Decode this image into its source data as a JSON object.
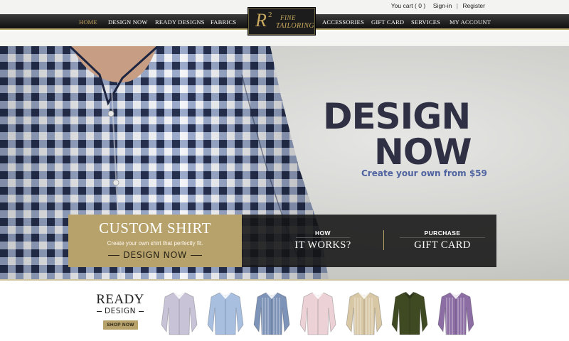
{
  "topbar": {
    "cart_text": "You cart ( 0 )",
    "signin": "Sign-in",
    "separator": "|",
    "register": "Register"
  },
  "nav": {
    "left": [
      "HOME",
      "DESIGN NOW",
      "READY DESIGNS",
      "FABRICS"
    ],
    "right": [
      "ACCESSORIES",
      "GIFT CARD",
      "SERVICES",
      "MY ACCOUNT"
    ],
    "active": "HOME",
    "active_color": "#c8a95d"
  },
  "logo": {
    "letter": "R",
    "superscript": "2",
    "line1": "FINE",
    "line2": "TAILORING"
  },
  "hero": {
    "title_line1": "DESIGN",
    "title_line2": "NOW",
    "subtitle": "Create your own from $59",
    "title_color": "#2f3044",
    "subtitle_color": "#5064a0"
  },
  "promo": {
    "custom_title": "CUSTOM SHIRT",
    "custom_desc": "Create your own shirt that perfectly fit.",
    "custom_cta": "DESIGN NOW",
    "how_small": "HOW",
    "how_big": "IT WORKS?",
    "purchase_small": "PURCHASE",
    "purchase_big": "GIFT CARD",
    "accent": "#b7a26b"
  },
  "ready": {
    "title": "READY",
    "subtitle": "DESIGN",
    "button": "SHOP NOW",
    "products": [
      {
        "name": "lavender-shirt",
        "color": "#c9c3d8"
      },
      {
        "name": "light-blue-shirt",
        "color": "#a8bfe0"
      },
      {
        "name": "blue-stripe-shirt",
        "color": "#7d93b8"
      },
      {
        "name": "pink-shirt",
        "color": "#ecd2d6"
      },
      {
        "name": "beige-stripe-shirt",
        "color": "#d8c8a6"
      },
      {
        "name": "olive-shirt",
        "color": "#3f4a22"
      },
      {
        "name": "purple-stripe-shirt",
        "color": "#8c6ea4"
      }
    ]
  }
}
